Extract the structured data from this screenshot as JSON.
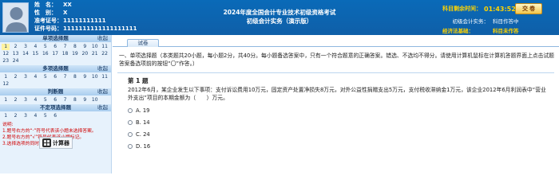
{
  "candidate": {
    "name_label": "姓　名：",
    "name": "XX",
    "gender_label": "性　别：",
    "gender": "X",
    "ticket_label": "准考证号：",
    "ticket": "11111111111",
    "id_label": "证件号码：",
    "id": "1111111111111111111"
  },
  "exam": {
    "title_line1": "2024年度全国会计专业技术初级资格考试",
    "title_line2": "初级会计实务（演示版）"
  },
  "timer": {
    "label": "科目剩余时间：",
    "value": "01:43:52",
    "submit": "交 卷"
  },
  "status": {
    "subject_label": "初级会计实务：",
    "subject_value": "科目作答中",
    "law_label": "经济法基础：",
    "law_value": "科目未作答"
  },
  "sections": [
    {
      "title": "单项选择题",
      "collapse": "收起",
      "questions": [
        "1",
        "2",
        "3",
        "4",
        "5",
        "6",
        "7",
        "8",
        "9",
        "10",
        "11",
        "12",
        "13",
        "14",
        "15",
        "16",
        "17",
        "18",
        "19",
        "20",
        "21",
        "22",
        "23",
        "24"
      ]
    },
    {
      "title": "多项选择题",
      "collapse": "收起",
      "questions": [
        "1",
        "2",
        "3",
        "4",
        "5",
        "6",
        "7",
        "8",
        "9",
        "10",
        "11",
        "12"
      ]
    },
    {
      "title": "判断题",
      "collapse": "收起",
      "questions": [
        "1",
        "2",
        "3",
        "4",
        "5",
        "6",
        "7",
        "8",
        "9",
        "10"
      ]
    },
    {
      "title": "不定项选择题",
      "collapse": "收起",
      "questions": [
        "1",
        "2",
        "3",
        "4",
        "5",
        "6"
      ]
    }
  ],
  "notes": {
    "title": "说明:",
    "line1": "1.题号右方的“·”符号代表该小题未选择答案。",
    "line2": "2.题号右方的“√”符号代表该小题标记。",
    "line3": "3.选择选项的同时自动保存答案。"
  },
  "calculator": {
    "label": "计算器"
  },
  "tab": {
    "label": "试卷"
  },
  "instructions": "一、单项选择题（本类题共20小题，每小题2分，共40分。每小题备选答案中，只有一个符合题意的正确答案。错选、不选均不得分。请使用计算机鼠标在计算机答题界面上点击试题答案备选项前的按钮“〇”作答。）",
  "question": {
    "title": "第 1 题",
    "text": "2012年6月，某企业发生以下事项：支付诉讼费用10万元，固定资产处置净损失8万元，对外公益性捐赠支出5万元，支付税收滞纳金1万元，该企业2012年6月利润表中“营业外支出”项目的本期金额为（　　）万元。",
    "options": [
      {
        "label": "A. 19"
      },
      {
        "label": "B. 14"
      },
      {
        "label": "C. 24"
      },
      {
        "label": "D. 16"
      }
    ]
  }
}
